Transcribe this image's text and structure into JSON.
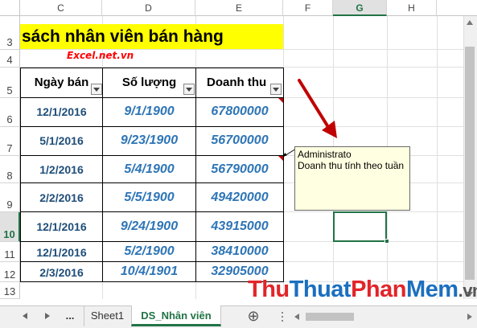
{
  "columns": [
    "C",
    "D",
    "E",
    "F",
    "G",
    "H"
  ],
  "rows": [
    "3",
    "4",
    "5",
    "6",
    "7",
    "8",
    "9",
    "10",
    "11",
    "12",
    "13"
  ],
  "title_text": "sách nhân viên bán hàng",
  "site_link": "Excel.net.vn",
  "table": {
    "headers": [
      "Ngày bán",
      "Số lượng",
      "Doanh thu"
    ],
    "rows": [
      [
        "12/1/2016",
        "9/1/1900",
        "67800000"
      ],
      [
        "5/1/2016",
        "9/23/1900",
        "56700000"
      ],
      [
        "1/2/2016",
        "5/4/1900",
        "56790000"
      ],
      [
        "2/2/2016",
        "5/5/1900",
        "49420000"
      ],
      [
        "12/1/2016",
        "9/24/1900",
        "43915000"
      ],
      [
        "12/1/2016",
        "5/2/1900",
        "38410000"
      ],
      [
        "2/3/2016",
        "10/4/1901",
        "32905000"
      ]
    ]
  },
  "comment": {
    "author": "Administrato",
    "text": "Doanh thu tính theo tuần"
  },
  "selected_column": "G",
  "selected_row": "10",
  "sheet_tabs": {
    "more": "...",
    "sheet1": "Sheet1",
    "active": "DS_Nhân viên",
    "add": "⊕"
  },
  "watermark": {
    "part1": "Thu",
    "part2": "Thuat",
    "part3": "Phan",
    "part4": "Mem",
    "part5": ".vn"
  },
  "colors": {
    "accent": "#217346",
    "title_bg": "#ffff00",
    "comment_bg": "#ffffe1",
    "arrow": "#c00000"
  },
  "icons": [
    "nav-left-icon",
    "nav-right-icon",
    "new-sheet-icon",
    "filter-dropdown-icon"
  ]
}
